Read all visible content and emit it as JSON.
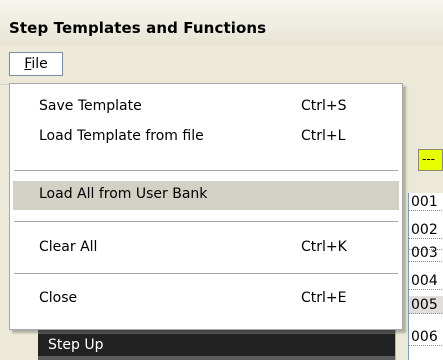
{
  "window": {
    "title": "Step Templates and Functions"
  },
  "menubar": {
    "file_prefix": "F",
    "file_rest": "ile"
  },
  "file_menu": {
    "items": [
      {
        "label": "Save Template",
        "shortcut": "Ctrl+S"
      },
      {
        "label": "Load Template from file",
        "shortcut": "Ctrl+L"
      },
      {
        "label": "Load All from User Bank",
        "shortcut": ""
      },
      {
        "label": "Clear All",
        "shortcut": "Ctrl+K"
      },
      {
        "label": "Close",
        "shortcut": "Ctrl+E"
      }
    ]
  },
  "background": {
    "field_value": "---",
    "numbers": [
      "001",
      "002",
      "003",
      "004",
      "005",
      "006"
    ],
    "step_item": "Step Up"
  },
  "colors": {
    "highlight_field": "#e6ff00",
    "menu_hover": "#d3d0c6"
  }
}
